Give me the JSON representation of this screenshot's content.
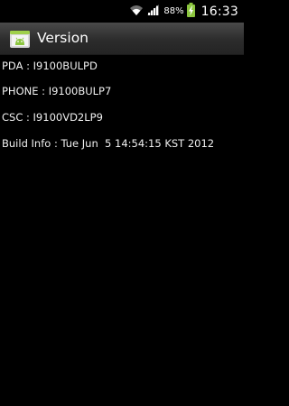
{
  "status_bar": {
    "battery_percent": "88%",
    "time": "16:33",
    "icons": [
      "wifi-icon",
      "signal-icon",
      "battery-charging-icon"
    ]
  },
  "title_bar": {
    "title": "Version",
    "icon": "android-settings-icon"
  },
  "info": {
    "pda": "PDA : I9100BULPD",
    "phone": "PHONE : I9100BULP7",
    "csc": "CSC : I9100VD2LP9",
    "build_info": "Build Info : Tue Jun  5 14:54:15 KST 2012"
  },
  "colors": {
    "background": "#000000",
    "text": "#f0f0f0",
    "battery_fill": "#8cc63f",
    "title_bar": "#2c2c2c"
  }
}
